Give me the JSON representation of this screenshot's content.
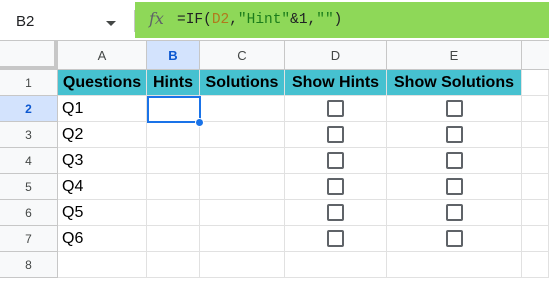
{
  "name_box": {
    "value": "B2"
  },
  "formula_bar": {
    "icon": "fx-icon",
    "parts": [
      "=IF(",
      "D2",
      ",",
      "\"Hint\"",
      "&1,",
      "\"\"",
      ")"
    ]
  },
  "columns": [
    "A",
    "B",
    "C",
    "D",
    "E"
  ],
  "selected_column": "B",
  "rows": [
    "1",
    "2",
    "3",
    "4",
    "5",
    "6",
    "7",
    "8"
  ],
  "selected_row": "2",
  "headers": {
    "questions": "Questions",
    "hints": "Hints",
    "solutions": "Solutions",
    "show_hints": "Show Hints",
    "show_solutions": "Show Solutions"
  },
  "questions": [
    "Q1",
    "Q2",
    "Q3",
    "Q4",
    "Q5",
    "Q6"
  ],
  "checkboxes": {
    "show_hints": [
      false,
      false,
      false,
      false,
      false,
      false
    ],
    "show_solutions": [
      false,
      false,
      false,
      false,
      false,
      false
    ]
  },
  "colors": {
    "formula_bar_bg": "#8ed858",
    "header_row_bg": "#46c1d0",
    "selection": "#1a73e8"
  }
}
